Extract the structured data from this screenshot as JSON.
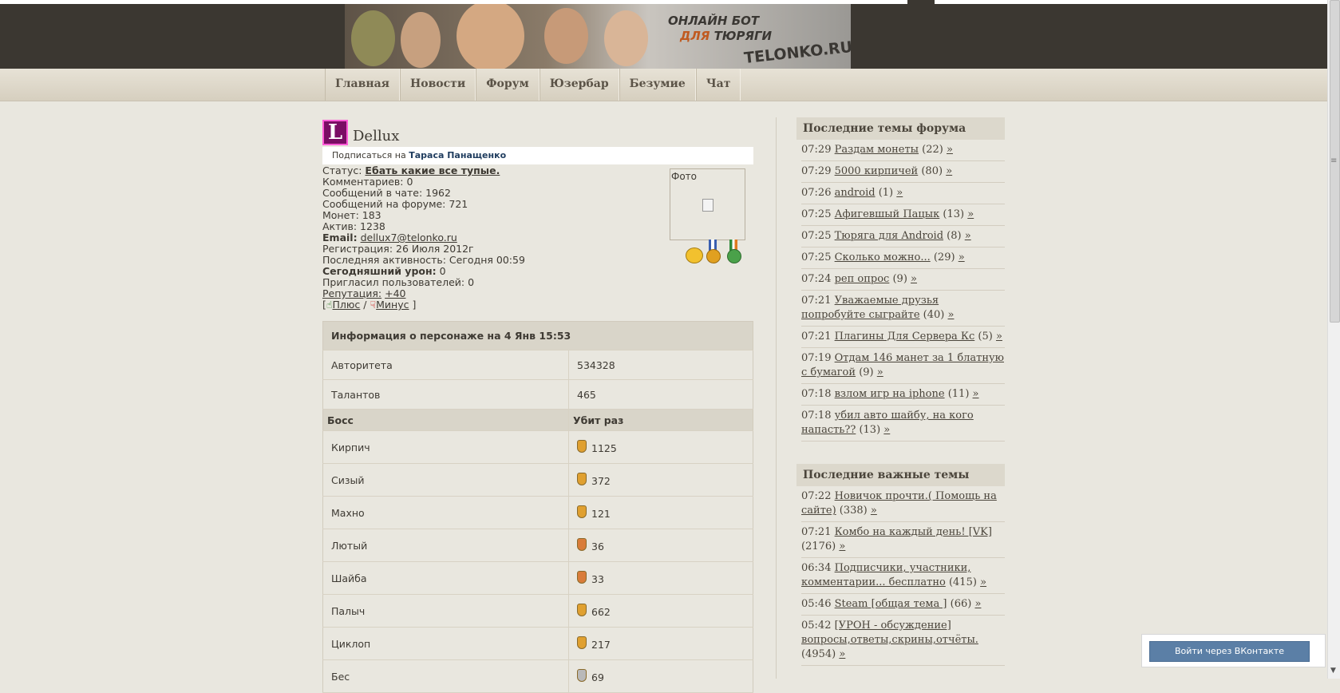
{
  "header": {
    "slogan_line1": "ОНЛАЙН БОТ",
    "slogan_line2_prefix": "ДЛЯ",
    "slogan_line2_suffix": "ТЮРЯГИ",
    "site_name": "TELONKO.RU"
  },
  "nav": [
    "Главная",
    "Новости",
    "Форум",
    "Юзербар",
    "Безумие",
    "Чат"
  ],
  "profile": {
    "avatar_letter": "L",
    "username": "Dellux",
    "subscribe_prefix": "Подписаться на",
    "subscribe_name": "Тараса Панащенко",
    "status_label": "Статус:",
    "status_value": "Ебать какие все тупые.",
    "comments": "Комментариев: 0",
    "chat_messages": "Сообщений в чате: 1962",
    "forum_messages": "Сообщений на форуме: 721",
    "coins": "Монет: 183",
    "activity": "Актив: 1238",
    "email_label": "Email:",
    "email_value": "dellux7@telonko.ru",
    "registration": "Регистрация: 26 Июля 2012г",
    "last_activity": "Последняя активность: Сегодня 00:59",
    "damage_label": "Сегодняшний урон:",
    "damage_value": "0",
    "invited": "Пригласил пользователей: 0",
    "reputation_label": "Репутация:",
    "reputation_value": "+40",
    "plus_label": "Плюс",
    "minus_label": "Минус",
    "photo_label": "Фото"
  },
  "character": {
    "title": "Информация о персонаже на 4 Янв 15:53",
    "stats": [
      {
        "label": "Авторитета",
        "value": "534328"
      },
      {
        "label": "Талантов",
        "value": "465"
      }
    ],
    "boss_col": "Босс",
    "kills_col": "Убит раз",
    "bosses": [
      {
        "name": "Кирпич",
        "kills": "1125",
        "medal": "#e0a030"
      },
      {
        "name": "Сизый",
        "kills": "372",
        "medal": "#e0a030"
      },
      {
        "name": "Махно",
        "kills": "121",
        "medal": "#e0a030"
      },
      {
        "name": "Лютый",
        "kills": "36",
        "medal": "#d97c3a"
      },
      {
        "name": "Шайба",
        "kills": "33",
        "medal": "#d97c3a"
      },
      {
        "name": "Палыч",
        "kills": "662",
        "medal": "#e0a030"
      },
      {
        "name": "Циклоп",
        "kills": "217",
        "medal": "#e0a030"
      },
      {
        "name": "Бес",
        "kills": "69",
        "medal": "#b9b9b9"
      }
    ]
  },
  "sidebar": {
    "forum_title": "Последние темы форума",
    "forum_topics": [
      {
        "time": "07:29",
        "title": "Раздам монеты",
        "count": "(22)"
      },
      {
        "time": "07:29",
        "title": "5000 кирпичей",
        "count": "(80)"
      },
      {
        "time": "07:26",
        "title": "android",
        "count": "(1)"
      },
      {
        "time": "07:25",
        "title": "Афигевшый Пацык",
        "count": "(13)"
      },
      {
        "time": "07:25",
        "title": "Тюряга для Android",
        "count": "(8)"
      },
      {
        "time": "07:25",
        "title": "Сколько можно...",
        "count": "(29)"
      },
      {
        "time": "07:24",
        "title": "реп опрос",
        "count": "(9)"
      },
      {
        "time": "07:21",
        "title": "Уважаемые друзья попробуйте сыграйте",
        "count": "(40)"
      },
      {
        "time": "07:21",
        "title": "Плагины Для Сервера Кс",
        "count": "(5)"
      },
      {
        "time": "07:19",
        "title": "Отдам 146 манет за 1 блатную с бумагой",
        "count": "(9)"
      },
      {
        "time": "07:18",
        "title": "взлом игр на iphone",
        "count": "(11)"
      },
      {
        "time": "07:18",
        "title": "убил авто шайбу, на кого напасть??",
        "count": "(13)"
      }
    ],
    "important_title": "Последние важные темы",
    "important_topics": [
      {
        "time": "07:22",
        "title": "Новичок прочти.( Помощь на сайте)",
        "count": "(338)"
      },
      {
        "time": "07:21",
        "title": "Комбо на каждый день! [VK]",
        "count": "(2176)"
      },
      {
        "time": "06:34",
        "title": "Подписчики, участники, комментарии... бесплатно",
        "count": "(415)"
      },
      {
        "time": "05:46",
        "title": "Steam [общая тема ]",
        "count": "(66)"
      },
      {
        "time": "05:42",
        "title": "[УРОН - обсуждение] вопросы,ответы,скрины,отчёты.",
        "count": "(4954)"
      }
    ],
    "more_glyph": "»"
  },
  "vk": {
    "button": "Войти через ВКонтакте"
  }
}
